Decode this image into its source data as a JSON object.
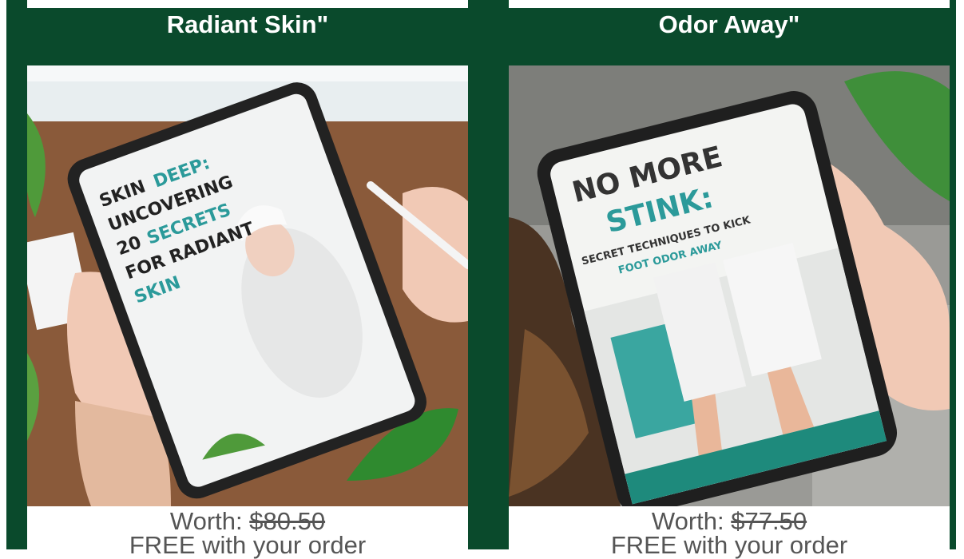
{
  "colors": {
    "brand_green": "#0a4a2c",
    "accent_teal": "#2b9a9a"
  },
  "cards": [
    {
      "title": "Radiant Skin\"",
      "worth_label": "Worth:",
      "original_price": "$80.50",
      "free_text": "FREE with your order",
      "ebook": {
        "line1a": "SKIN",
        "line1b": "DEEP:",
        "line2": "UNCOVERING",
        "line3a": "20",
        "line3b": "SECRETS",
        "line4": "FOR RADIANT",
        "line5": "SKIN"
      }
    },
    {
      "title": "Odor Away\"",
      "worth_label": "Worth:",
      "original_price": "$77.50",
      "free_text": "FREE with your order",
      "ebook": {
        "line1": "NO MORE",
        "line2": "STINK:",
        "line3": "SECRET TECHNIQUES TO KICK",
        "line4": "FOOT ODOR AWAY"
      }
    }
  ]
}
